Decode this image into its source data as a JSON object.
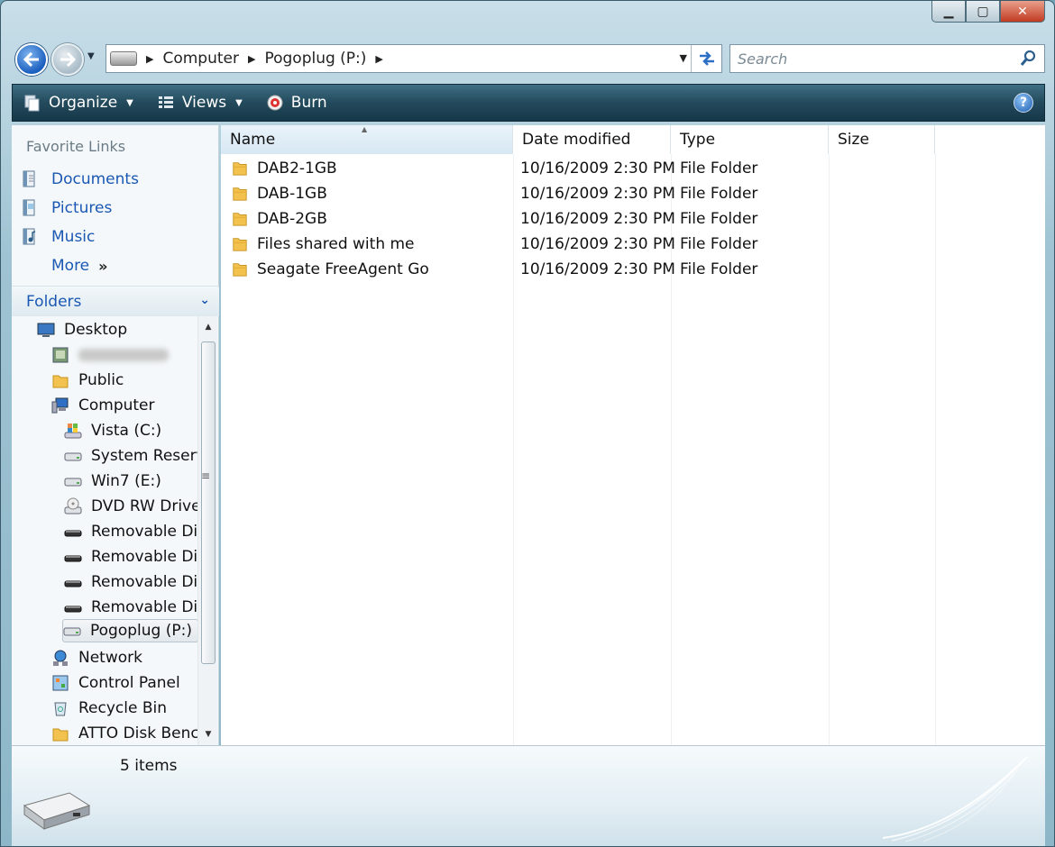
{
  "window": {
    "caption_buttons": {
      "minimize": "▁",
      "maximize": "▢",
      "close": "✕"
    }
  },
  "nav": {
    "breadcrumb": [
      "Computer",
      "Pogoplug (P:)"
    ],
    "search_placeholder": "Search"
  },
  "toolbar": {
    "organize": "Organize",
    "views": "Views",
    "burn": "Burn",
    "help": "?"
  },
  "sidebar": {
    "favorites_title": "Favorite Links",
    "favorites": [
      {
        "label": "Documents",
        "icon": "documents-icon"
      },
      {
        "label": "Pictures",
        "icon": "pictures-icon"
      },
      {
        "label": "Music",
        "icon": "music-icon"
      }
    ],
    "more_label": "More",
    "more_arrows": "»",
    "folders_title": "Folders",
    "tree": [
      {
        "label": "Desktop",
        "icon": "desktop-icon"
      },
      {
        "label": "",
        "icon": "user-folder-icon",
        "blurred": true
      },
      {
        "label": "Public",
        "icon": "folder-icon"
      },
      {
        "label": "Computer",
        "icon": "computer-icon"
      },
      {
        "label": "Vista (C:)",
        "icon": "windows-drive-icon"
      },
      {
        "label": "System Reserve",
        "icon": "drive-icon"
      },
      {
        "label": "Win7 (E:)",
        "icon": "drive-icon"
      },
      {
        "label": "DVD RW Drive",
        "icon": "dvd-drive-icon"
      },
      {
        "label": "Removable Dis",
        "icon": "removable-disk-icon"
      },
      {
        "label": "Removable Dis",
        "icon": "removable-disk-icon"
      },
      {
        "label": "Removable Dis",
        "icon": "removable-disk-icon"
      },
      {
        "label": "Removable Dis",
        "icon": "removable-disk-icon"
      },
      {
        "label": "Pogoplug (P:)",
        "icon": "network-drive-icon",
        "selected": true
      },
      {
        "label": "Network",
        "icon": "network-icon"
      },
      {
        "label": "Control Panel",
        "icon": "control-panel-icon"
      },
      {
        "label": "Recycle Bin",
        "icon": "recycle-bin-icon"
      },
      {
        "label": "ATTO Disk Bencl",
        "icon": "folder-icon"
      }
    ]
  },
  "file_list": {
    "columns": [
      "Name",
      "Date modified",
      "Type",
      "Size"
    ],
    "rows": [
      {
        "name": "DAB2-1GB",
        "date": "10/16/2009 2:30 PM",
        "type": "File Folder",
        "size": ""
      },
      {
        "name": "DAB-1GB",
        "date": "10/16/2009 2:30 PM",
        "type": "File Folder",
        "size": ""
      },
      {
        "name": "DAB-2GB",
        "date": "10/16/2009 2:30 PM",
        "type": "File Folder",
        "size": ""
      },
      {
        "name": "Files shared with me",
        "date": "10/16/2009 2:30 PM",
        "type": "File Folder",
        "size": ""
      },
      {
        "name": "Seagate FreeAgent Go",
        "date": "10/16/2009 2:30 PM",
        "type": "File Folder",
        "size": ""
      }
    ]
  },
  "details_pane": {
    "item_count": "5 items"
  },
  "colors": {
    "link_blue": "#1a58b3",
    "command_bar": "#234a5c",
    "folder_yellow": "#f2c14e"
  }
}
